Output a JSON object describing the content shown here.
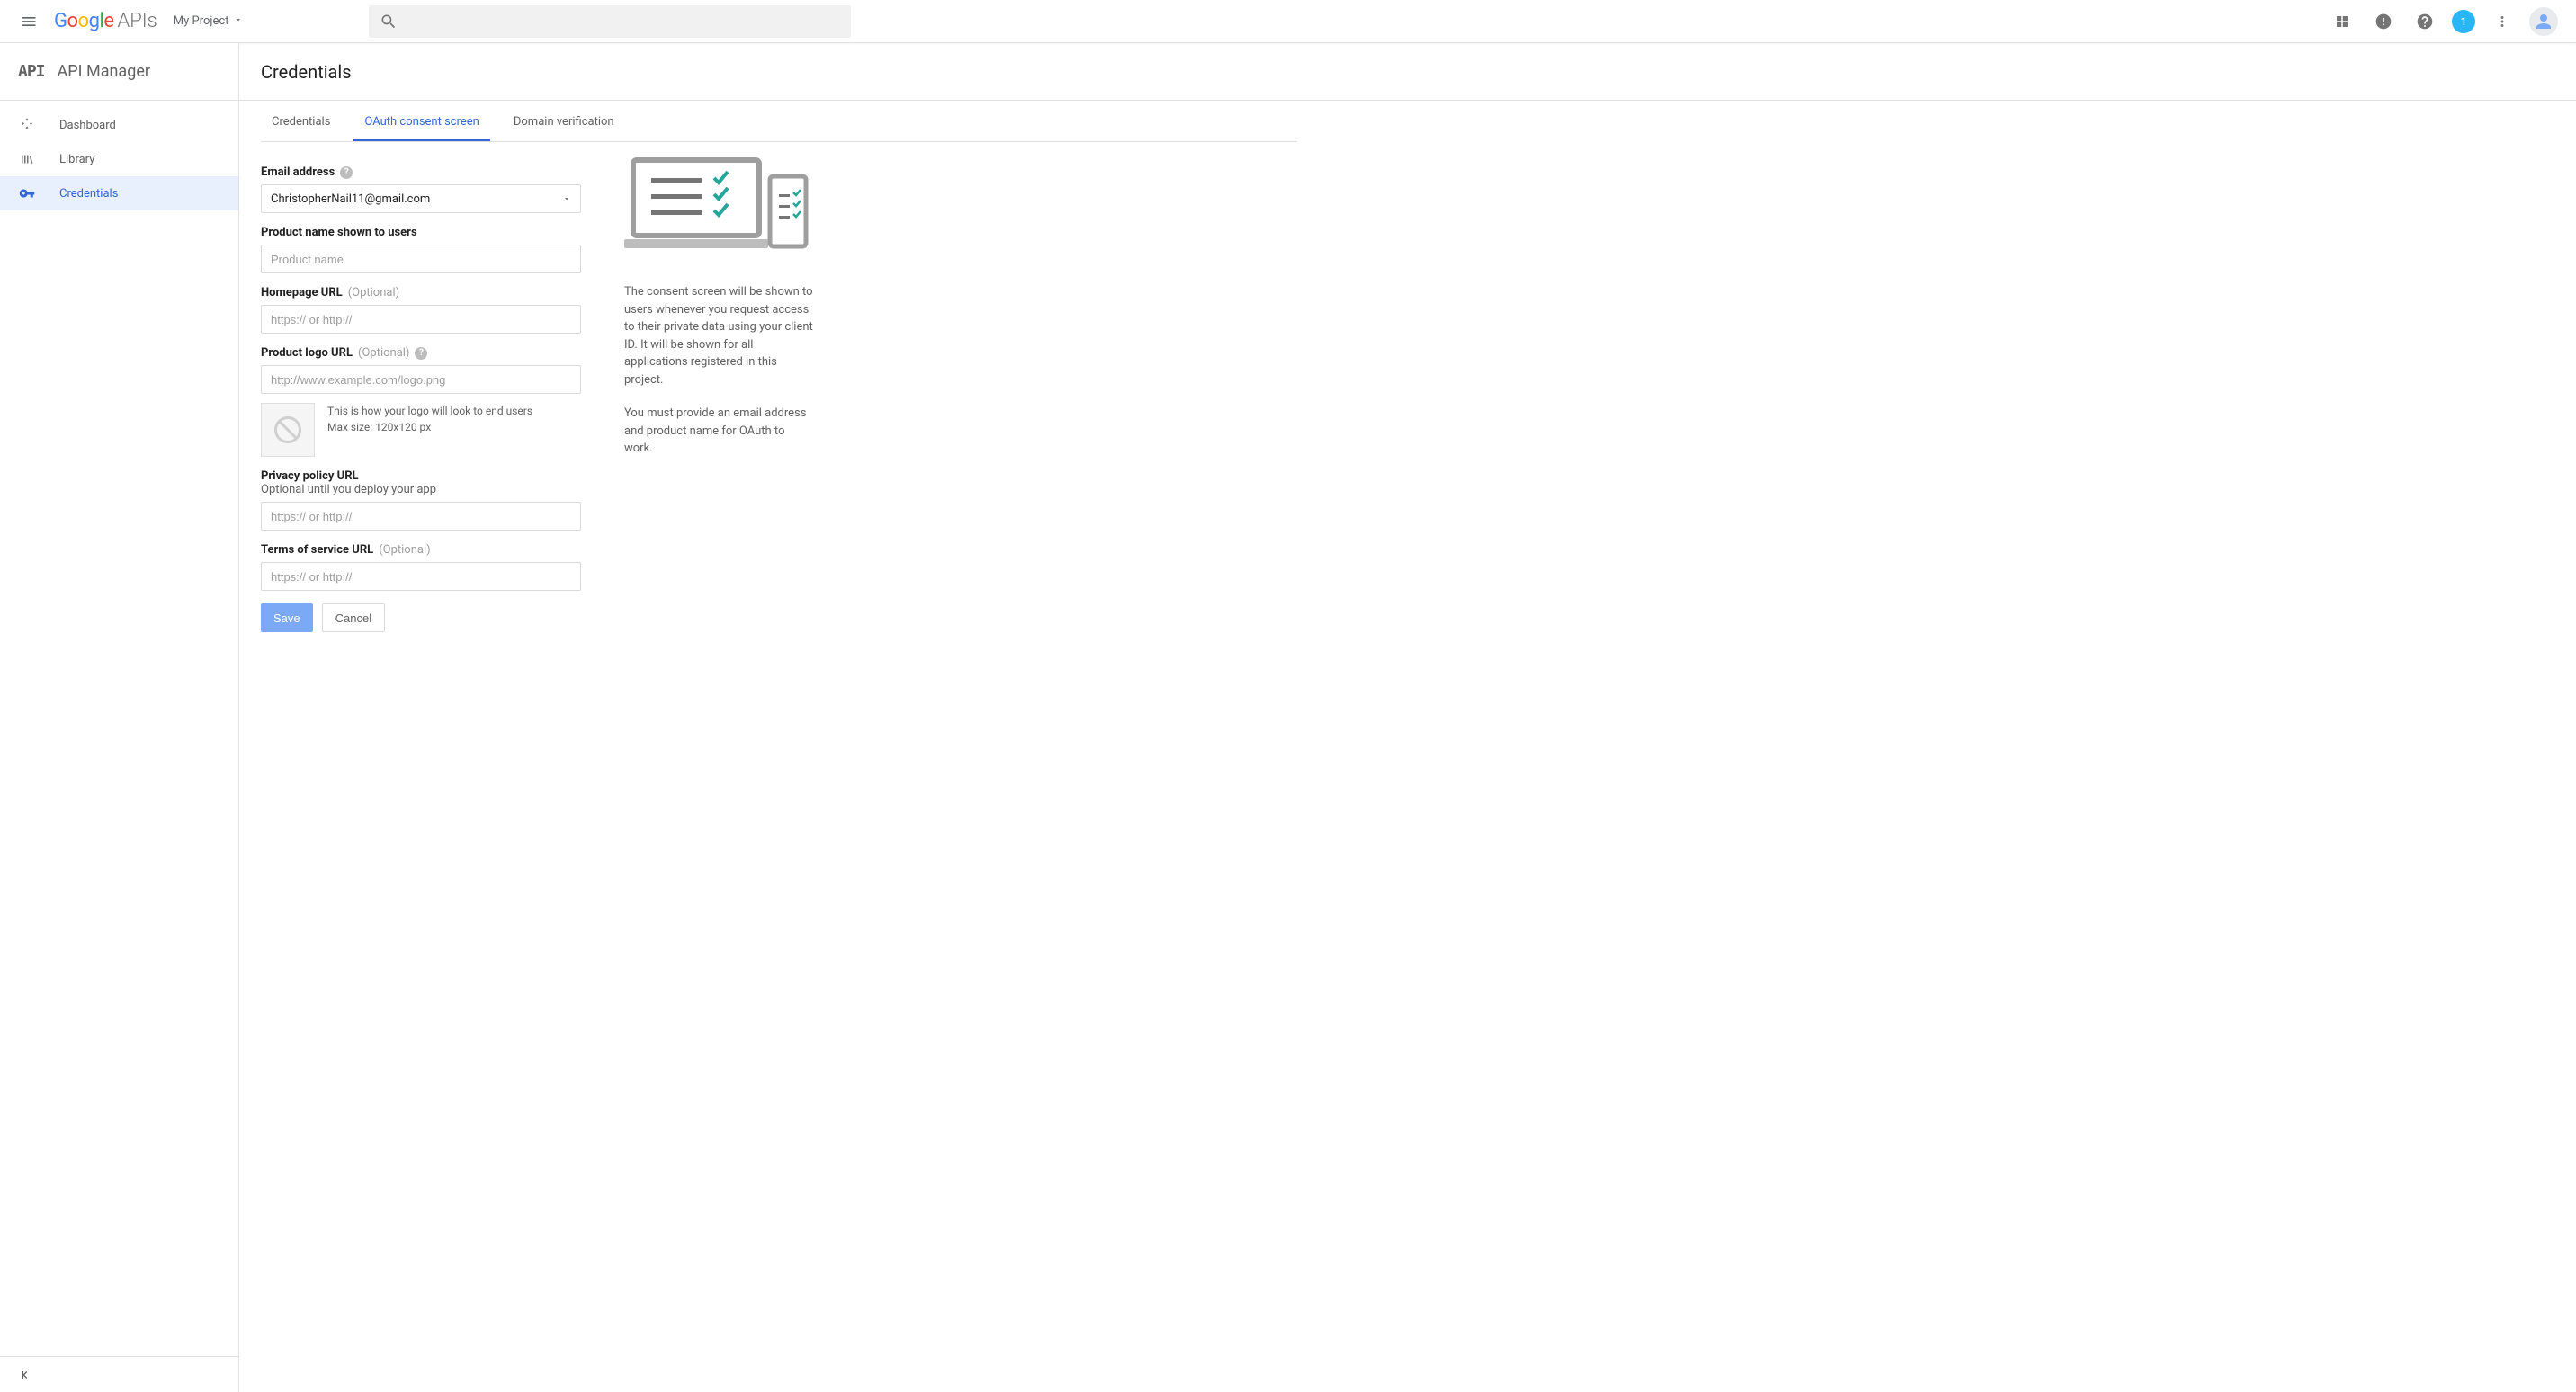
{
  "header": {
    "logo_apis": "APIs",
    "project_name": "My Project"
  },
  "topbar": {
    "notification_count": "1"
  },
  "sidebar": {
    "product_title": "API Manager",
    "items": [
      {
        "label": "Dashboard"
      },
      {
        "label": "Library"
      },
      {
        "label": "Credentials"
      }
    ]
  },
  "page": {
    "title": "Credentials",
    "tabs": [
      {
        "label": "Credentials"
      },
      {
        "label": "OAuth consent screen"
      },
      {
        "label": "Domain verification"
      }
    ]
  },
  "form": {
    "email_label": "Email address",
    "email_value": "ChristopherNail11@gmail.com",
    "product_label": "Product name shown to users",
    "product_placeholder": "Product name",
    "homepage_label": "Homepage URL",
    "homepage_optional": "(Optional)",
    "homepage_placeholder": "https:// or http://",
    "logo_label": "Product logo URL",
    "logo_optional": "(Optional)",
    "logo_placeholder": "http://www.example.com/logo.png",
    "logo_hint1": "This is how your logo will look to end users",
    "logo_hint2": "Max size: 120x120 px",
    "privacy_label": "Privacy policy URL",
    "privacy_sub": "Optional until you deploy your app",
    "privacy_placeholder": "https:// or http://",
    "tos_label": "Terms of service URL",
    "tos_optional": "(Optional)",
    "tos_placeholder": "https:// or http://",
    "save_label": "Save",
    "cancel_label": "Cancel"
  },
  "sideinfo": {
    "para1": "The consent screen will be shown to users whenever you request access to their private data using your client ID. It will be shown for all applications registered in this project.",
    "para2": "You must provide an email address and product name for OAuth to work."
  }
}
